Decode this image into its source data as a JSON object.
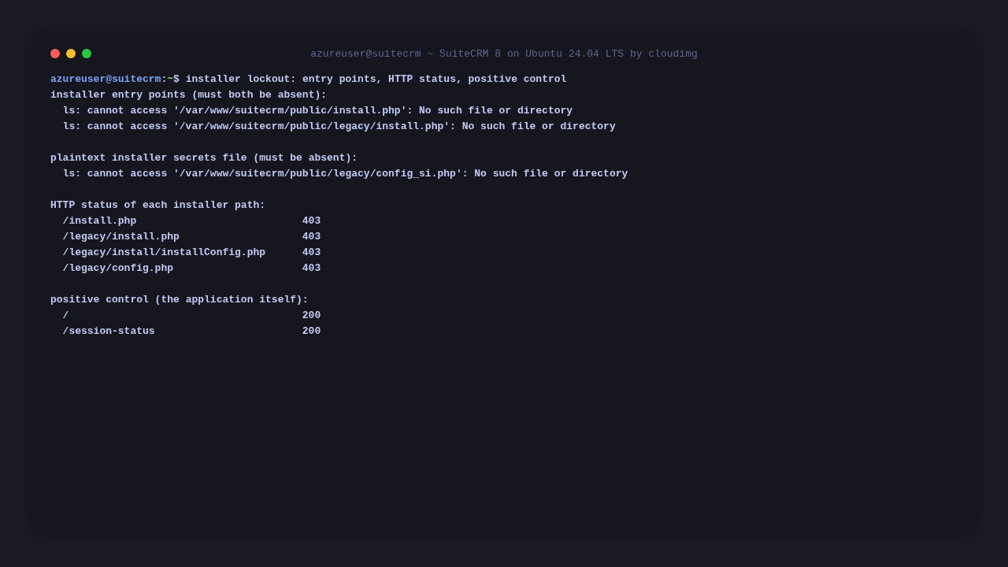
{
  "window": {
    "title": "azureuser@suitecrm ~ SuiteCRM 8 on Ubuntu 24.04 LTS by cloudimg"
  },
  "prompt": {
    "user": "azureuser@suitecrm",
    "separator": ":",
    "path": "~",
    "symbol": "$",
    "command": "installer lockout: entry points, HTTP status, positive control"
  },
  "lines": [
    {
      "kind": "heading",
      "text": "installer entry points (must both be absent):"
    },
    {
      "kind": "output",
      "text": "ls: cannot access '/var/www/suitecrm/public/install.php': No such file or directory"
    },
    {
      "kind": "output",
      "text": "ls: cannot access '/var/www/suitecrm/public/legacy/install.php': No such file or directory"
    },
    {
      "kind": "blank"
    },
    {
      "kind": "heading",
      "text": "plaintext installer secrets file (must be absent):"
    },
    {
      "kind": "output",
      "text": "ls: cannot access '/var/www/suitecrm/public/legacy/config_si.php': No such file or directory"
    },
    {
      "kind": "blank"
    },
    {
      "kind": "heading",
      "text": "HTTP status of each installer path:"
    },
    {
      "kind": "row",
      "path": "/install.php",
      "status": "403"
    },
    {
      "kind": "row",
      "path": "/legacy/install.php",
      "status": "403"
    },
    {
      "kind": "row",
      "path": "/legacy/install/installConfig.php",
      "status": "403"
    },
    {
      "kind": "row",
      "path": "/legacy/config.php",
      "status": "403"
    },
    {
      "kind": "blank"
    },
    {
      "kind": "heading",
      "text": "positive control (the application itself):"
    },
    {
      "kind": "row",
      "path": "/",
      "status": "200"
    },
    {
      "kind": "row",
      "path": "/session-status",
      "status": "200"
    }
  ]
}
